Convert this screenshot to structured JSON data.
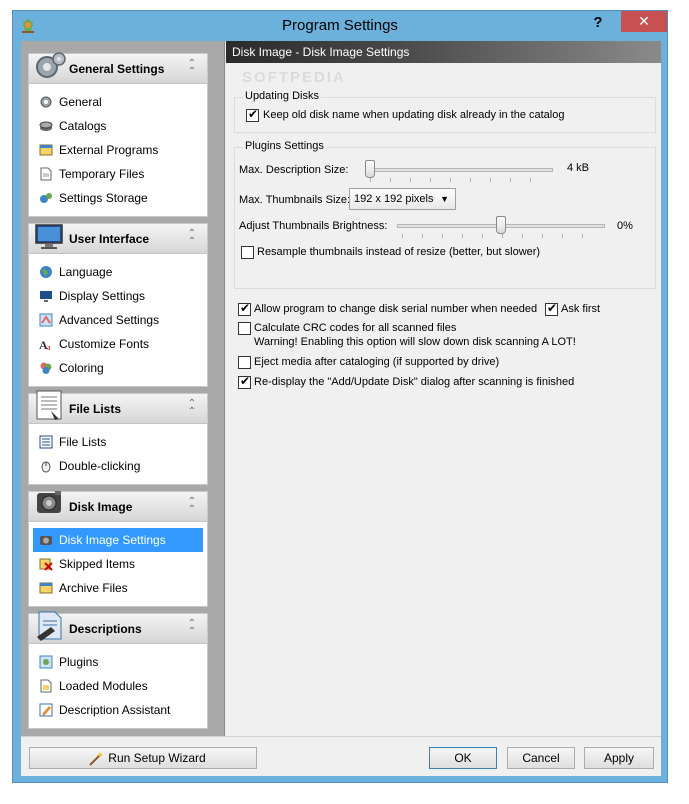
{
  "window": {
    "title": "Program Settings",
    "help_label": "?",
    "close_label": "✕"
  },
  "nav": {
    "groups": [
      {
        "title": "General Settings",
        "icon": "gears-icon",
        "items": [
          {
            "label": "General",
            "icon": "gear-icon"
          },
          {
            "label": "Catalogs",
            "icon": "catalog-icon"
          },
          {
            "label": "External Programs",
            "icon": "program-icon"
          },
          {
            "label": "Temporary Files",
            "icon": "temp-file-icon"
          },
          {
            "label": "Settings Storage",
            "icon": "storage-icon"
          }
        ]
      },
      {
        "title": "User Interface",
        "icon": "monitor-icon",
        "items": [
          {
            "label": "Language",
            "icon": "globe-icon"
          },
          {
            "label": "Display Settings",
            "icon": "display-icon"
          },
          {
            "label": "Advanced Settings",
            "icon": "advanced-icon"
          },
          {
            "label": "Customize Fonts",
            "icon": "font-icon"
          },
          {
            "label": "Coloring",
            "icon": "palette-icon"
          }
        ]
      },
      {
        "title": "File Lists",
        "icon": "file-list-icon",
        "items": [
          {
            "label": "File Lists",
            "icon": "list-icon"
          },
          {
            "label": "Double-clicking",
            "icon": "mouse-icon"
          }
        ]
      },
      {
        "title": "Disk Image",
        "icon": "disk-image-icon",
        "items": [
          {
            "label": "Disk Image Settings",
            "icon": "disk-settings-icon",
            "selected": true
          },
          {
            "label": "Skipped Items",
            "icon": "skipped-icon"
          },
          {
            "label": "Archive Files",
            "icon": "archive-icon"
          }
        ]
      },
      {
        "title": "Descriptions",
        "icon": "descriptions-icon",
        "items": [
          {
            "label": "Plugins",
            "icon": "plugin-icon"
          },
          {
            "label": "Loaded Modules",
            "icon": "module-icon"
          },
          {
            "label": "Description Assistant",
            "icon": "assistant-icon"
          }
        ]
      }
    ]
  },
  "panel": {
    "header": "Disk Image - Disk Image Settings",
    "updating_disks": {
      "legend": "Updating Disks",
      "keep_old_name": {
        "label": "Keep old disk name when updating disk already in the catalog",
        "checked": true
      }
    },
    "plugins_settings": {
      "legend": "Plugins Settings",
      "max_description_size": {
        "label": "Max. Description Size:",
        "value": "4 kB",
        "fraction": 0.0
      },
      "max_thumbnails_size": {
        "label": "Max. Thumbnails Size:",
        "selected": "192 x 192 pixels"
      },
      "brightness": {
        "label": "Adjust Thumbnails Brightness:",
        "value": "0%",
        "fraction": 0.5
      },
      "resample": {
        "label": "Resample thumbnails instead of resize (better, but slower)",
        "checked": false
      }
    },
    "allow_serial_change": {
      "label": "Allow program to change disk serial number when needed",
      "checked": true
    },
    "ask_first": {
      "label": "Ask first",
      "checked": true
    },
    "calculate_crc": {
      "label": "Calculate CRC codes for all scanned files",
      "checked": false,
      "warning": "Warning! Enabling this option will slow down disk scanning A LOT!"
    },
    "eject_media": {
      "label": "Eject media after cataloging (if supported by drive)",
      "checked": false
    },
    "redisplay_dialog": {
      "label": "Re-display the \"Add/Update Disk\" dialog after scanning is finished",
      "checked": true
    }
  },
  "footer": {
    "wizard_label": "Run Setup Wizard",
    "ok_label": "OK",
    "cancel_label": "Cancel",
    "apply_label": "Apply"
  },
  "watermark": "SOFTPEDIA"
}
